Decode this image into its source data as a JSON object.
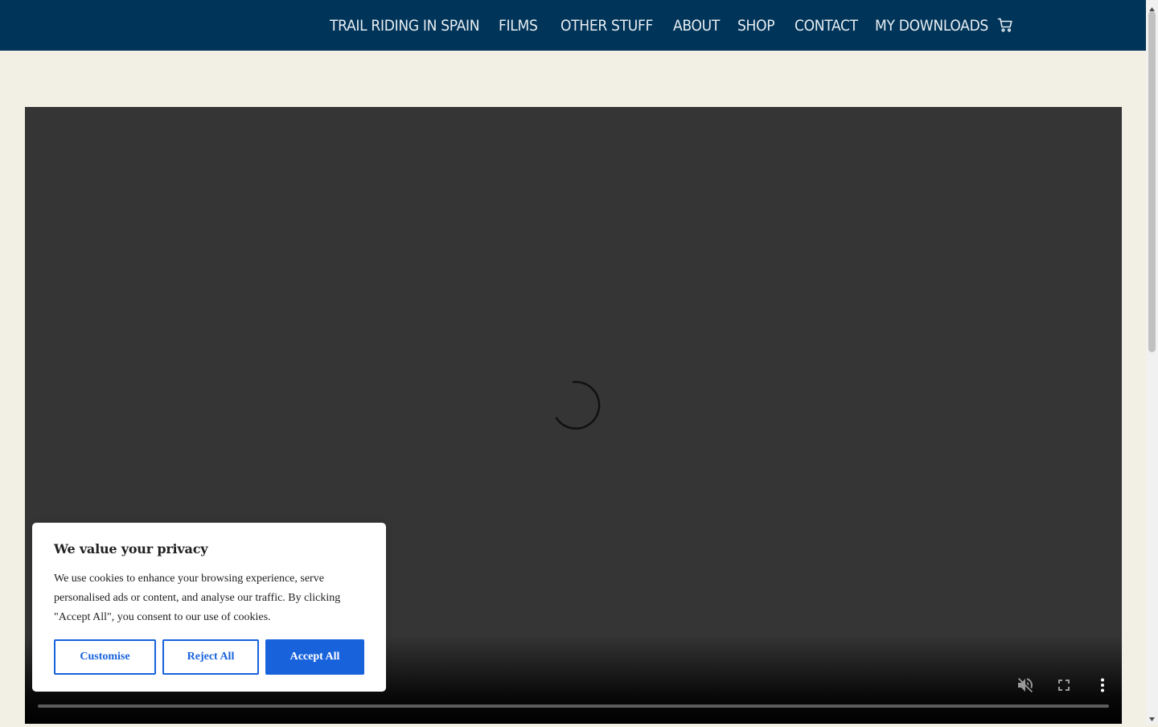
{
  "nav": {
    "items": [
      {
        "label": "TRAIL RIDING IN SPAIN"
      },
      {
        "label": "FILMS"
      },
      {
        "label": "OTHER STUFF"
      },
      {
        "label": "ABOUT"
      },
      {
        "label": "SHOP"
      },
      {
        "label": "CONTACT"
      },
      {
        "label": "MY DOWNLOADS"
      }
    ],
    "cart_icon": "shopping-cart-icon"
  },
  "video": {
    "state": "loading",
    "controls": {
      "mute_icon": "volume-muted-icon",
      "fullscreen_icon": "fullscreen-icon",
      "more_icon": "more-vertical-icon"
    }
  },
  "cookie_banner": {
    "title": "We value your privacy",
    "text": "We use cookies to enhance your browsing experience, serve personalised ads or content, and analyse our traffic. By clicking \"Accept All\", you consent to our use of cookies.",
    "customise_label": "Customise",
    "reject_label": "Reject All",
    "accept_label": "Accept All"
  },
  "colors": {
    "header_bg": "#003459",
    "page_bg": "#f2f0e4",
    "video_bg": "#353535",
    "accent": "#1863dc"
  }
}
